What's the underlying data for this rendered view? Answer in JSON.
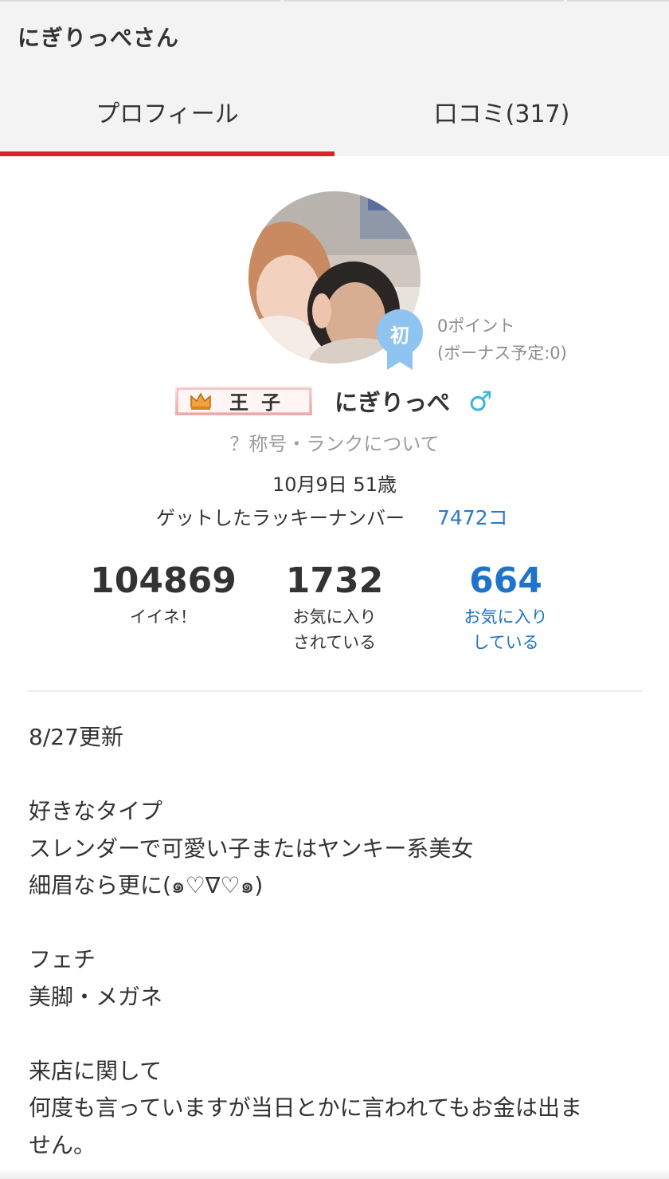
{
  "header": {
    "title": "にぎりっぺさん",
    "tabs": [
      {
        "label": "プロフィール",
        "active": true
      },
      {
        "label": "口コミ(317)",
        "active": false
      }
    ],
    "accent_color": "#d8232a"
  },
  "profile": {
    "avatar_icon": "profile-photo",
    "first_badge": "初",
    "points": "0ポイント",
    "bonus": "(ボーナス予定:0)",
    "rank_title": "王子",
    "username": "にぎりっぺ",
    "gender_symbol": "♂",
    "title_rank_link": "？称号・ランクについて",
    "birthday_age": "10月9日 51歳",
    "lucky_label": "ゲットしたラッキーナンバー",
    "lucky_value": "7472コ"
  },
  "stats": [
    {
      "number": "104869",
      "label_line1": "イイネ！",
      "label_line2": ""
    },
    {
      "number": "1732",
      "label_line1": "お気に入り",
      "label_line2": "されている"
    },
    {
      "number": "664",
      "label_line1": "お気に入り",
      "label_line2": "している",
      "color": "#1f73c9"
    }
  ],
  "bio": [
    "8/27更新",
    "",
    "好きなタイプ",
    "スレンダーで可愛い子またはヤンキー系美女",
    "細眉なら更に(๑♡∇♡๑)",
    "",
    "フェチ",
    "美脚・メガネ",
    "",
    "来店に関して",
    "何度も言っていますが当日とかに言われてもお金は出ま",
    "せん。"
  ]
}
